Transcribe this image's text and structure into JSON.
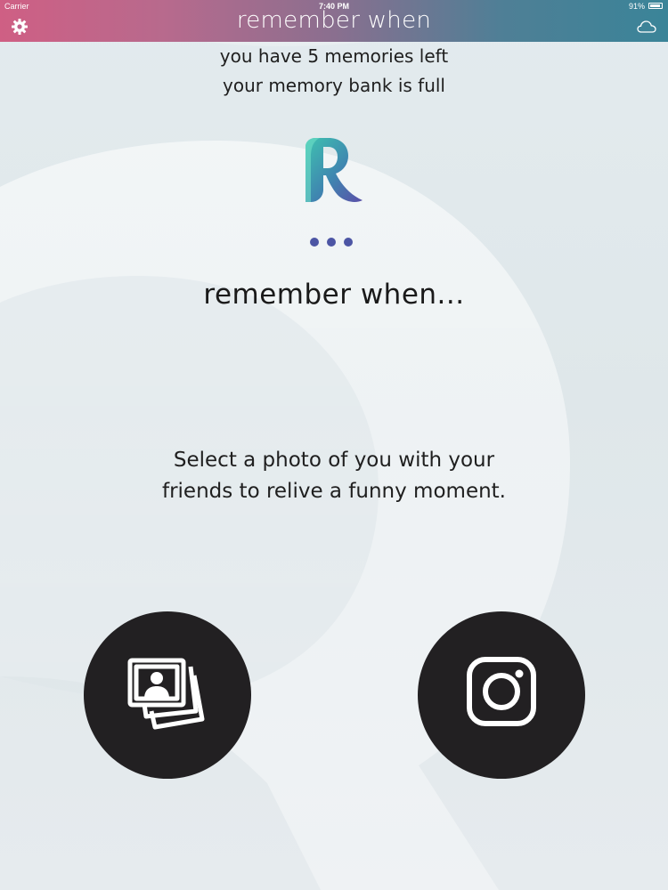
{
  "status_bar": {
    "carrier": "Carrier",
    "time": "7:40 PM",
    "battery": "91%"
  },
  "header": {
    "title": "remember when",
    "left_icon": "gear-icon",
    "right_icon": "cloud-icon",
    "gradient_colors": [
      "#cf5f84",
      "#3a8498"
    ]
  },
  "memory_info": {
    "line1": "you have 5 memories left",
    "line2": "your memory bank is full"
  },
  "logo": {
    "icon": "r-logo-icon",
    "colors": [
      "#3fc3b0",
      "#5a4fa8"
    ]
  },
  "loading_dots_color": "#4c55a4",
  "subtitle": "remember when...",
  "instructions": {
    "line1": "Select a photo of you with your",
    "line2": "friends to relive a funny moment."
  },
  "buttons": {
    "photo_library_icon": "photo-library-icon",
    "instagram_icon": "instagram-icon",
    "button_color": "#222022"
  }
}
